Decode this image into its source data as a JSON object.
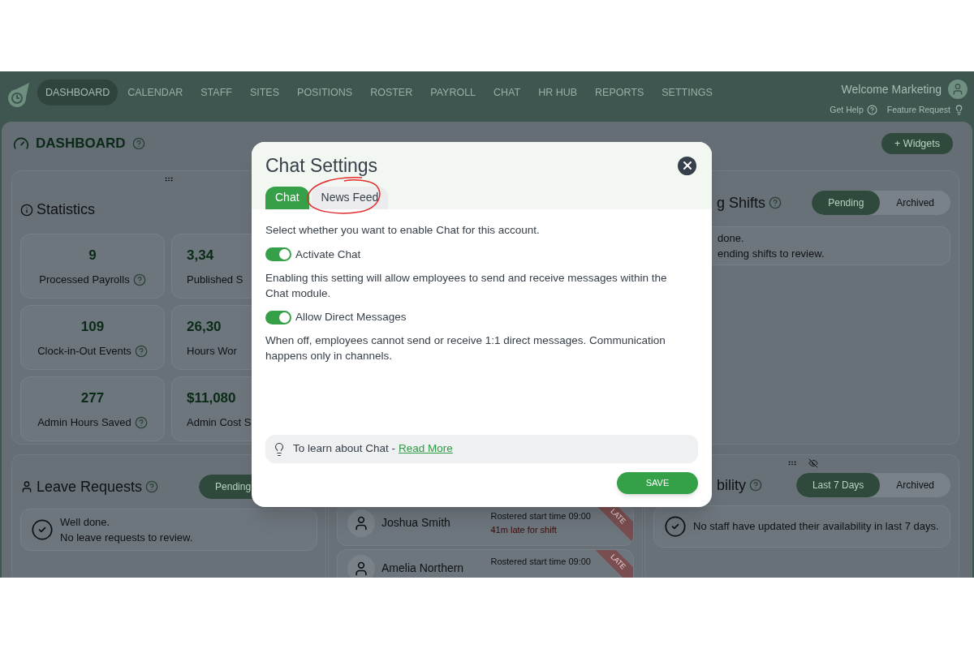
{
  "nav": {
    "items": [
      {
        "label": "DASHBOARD",
        "selected": true
      },
      {
        "label": "CALENDAR",
        "selected": false
      },
      {
        "label": "STAFF",
        "selected": false
      },
      {
        "label": "SITES",
        "selected": false
      },
      {
        "label": "POSITIONS",
        "selected": false
      },
      {
        "label": "ROSTER",
        "selected": false
      },
      {
        "label": "PAYROLL",
        "selected": false
      },
      {
        "label": "CHAT",
        "selected": false
      },
      {
        "label": "HR HUB",
        "selected": false
      },
      {
        "label": "REPORTS",
        "selected": false
      },
      {
        "label": "SETTINGS",
        "selected": false
      }
    ],
    "welcome": "Welcome Marketing",
    "links": [
      "Get Help",
      "Feature Request"
    ]
  },
  "dashboard": {
    "title": "DASHBOARD",
    "widgets_button": "+ Widgets"
  },
  "statistics": {
    "title": "Statistics",
    "tiles": [
      {
        "value": "9",
        "label": "Processed Payrolls"
      },
      {
        "value": "3,34",
        "label": "Published S"
      },
      {
        "value": "109",
        "label": "Clock-in-Out Events"
      },
      {
        "value": "26,30",
        "label": "Hours Wor"
      },
      {
        "value": "277",
        "label": "Admin Hours Saved"
      },
      {
        "value": "$11,080",
        "label": "Admin Cost S"
      }
    ]
  },
  "leave_requests": {
    "title": "Leave Requests",
    "filters": [
      {
        "label": "Pending",
        "selected": true
      }
    ],
    "message": [
      "Well done.",
      "No leave requests to review."
    ]
  },
  "shifts": {
    "title": "g Shifts",
    "filters": [
      {
        "label": "Pending",
        "selected": true
      },
      {
        "label": "Archived",
        "selected": false
      }
    ],
    "message": [
      "done.",
      "ending shifts to review."
    ]
  },
  "late_staff": [
    {
      "name": "Joshua Smith",
      "rostered": "Rostered start time 09:00",
      "late": "41m late for shift",
      "tag": "LATE"
    },
    {
      "name": "Amelia Northern",
      "rostered": "Rostered start time 09:00",
      "tag": "LATE"
    }
  ],
  "availability": {
    "title": "bility",
    "filters": [
      {
        "label": "Last 7 Days",
        "selected": true
      },
      {
        "label": "Archived",
        "selected": false
      }
    ],
    "message": "No staff have updated their availability in last 7 days."
  },
  "modal": {
    "title": "Chat Settings",
    "tabs": [
      {
        "label": "Chat",
        "selected": true
      },
      {
        "label": "News Feed",
        "selected": false,
        "annotated": true
      }
    ],
    "intro": "Select whether you want to enable Chat for this account.",
    "settings": [
      {
        "label": "Activate Chat",
        "on": true,
        "description": "Enabling this setting will allow employees to send and receive messages within the Chat module."
      },
      {
        "label": "Allow Direct Messages",
        "on": true,
        "description": "When off, employees cannot send or receive 1:1 direct messages. Communication happens only in channels."
      }
    ],
    "tip": {
      "text": "To learn about Chat - ",
      "link": "Read More"
    },
    "save": "SAVE"
  }
}
